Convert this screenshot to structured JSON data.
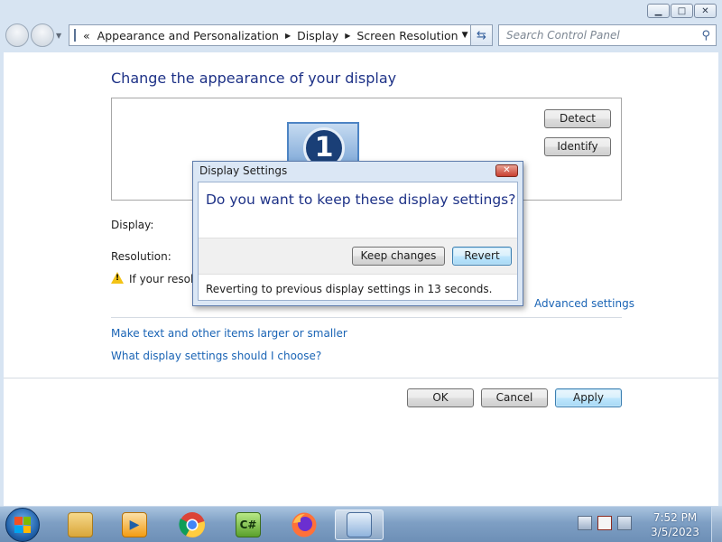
{
  "window": {
    "caption_buttons": [
      "minimize",
      "maximize",
      "close"
    ]
  },
  "nav": {
    "breadcrumb_prefix": "«",
    "breadcrumbs": [
      "Appearance and Personalization",
      "Display",
      "Screen Resolution"
    ],
    "search_placeholder": "Search Control Panel"
  },
  "main": {
    "title": "Change the appearance of your display",
    "monitor_number": "1",
    "detect_label": "Detect",
    "identify_label": "Identify",
    "display_label": "Display:",
    "resolution_label": "Resolution:",
    "warning_text": "If your resolu",
    "advanced_link": "Advanced settings",
    "link_text_size": "Make text and other items larger or smaller",
    "link_display_help": "What display settings should I choose?",
    "ok_label": "OK",
    "cancel_label": "Cancel",
    "apply_label": "Apply"
  },
  "dialog": {
    "title": "Display Settings",
    "question": "Do you want to keep these display settings?",
    "keep_label": "Keep changes",
    "revert_label": "Revert",
    "countdown_text": "Reverting to previous display settings in 13 seconds."
  },
  "taskbar": {
    "apps": [
      "file-explorer",
      "media-player",
      "chrome",
      "csharp-ide",
      "firefox",
      "control-panel"
    ],
    "active_app": "control-panel",
    "clock_time": "7:52 PM",
    "clock_date": "3/5/2023"
  },
  "colors": {
    "title_blue": "#1e3287",
    "link_blue": "#1a64b5",
    "frame": "#d7e4f2",
    "focus_button": "#a7d9f5"
  }
}
